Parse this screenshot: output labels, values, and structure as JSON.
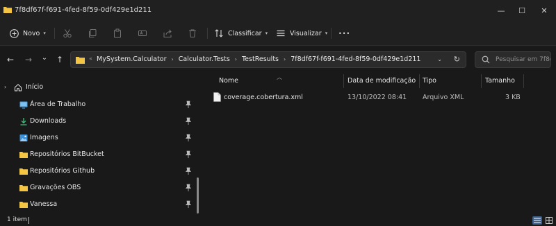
{
  "window": {
    "title": "7f8df67f-f691-4fed-8f59-0df429e1d211",
    "minimize_glyph": "—",
    "maximize_glyph": "☐",
    "close_glyph": "✕"
  },
  "toolbar": {
    "new_label": "Novo",
    "sort_label": "Classificar",
    "view_label": "Visualizar",
    "more_label": "•••",
    "icons": [
      "cut-icon",
      "copy-icon",
      "paste-icon",
      "rename-icon",
      "share-icon",
      "delete-icon"
    ]
  },
  "navigation": {
    "back_glyph": "←",
    "forward_glyph": "→",
    "recent_glyph": "⌄",
    "up_glyph": "↑"
  },
  "address": {
    "overflow": "«",
    "crumbs": [
      "MySystem.Calculator",
      "Calculator.Tests",
      "TestResults",
      "7f8df67f-f691-4fed-8f59-0df429e1d211"
    ],
    "separator": "›",
    "dropdown_glyph": "⌄",
    "refresh_glyph": "↻"
  },
  "search": {
    "placeholder": "Pesquisar em 7f8d..."
  },
  "sidebar": {
    "home_label": "Início",
    "items": [
      {
        "label": "Área de Trabalho",
        "icon": "desktop-icon"
      },
      {
        "label": "Downloads",
        "icon": "download-icon"
      },
      {
        "label": "Imagens",
        "icon": "pictures-icon"
      },
      {
        "label": "Repositórios BitBucket",
        "icon": "folder-icon"
      },
      {
        "label": "Repositórios Github",
        "icon": "folder-icon"
      },
      {
        "label": "Gravações OBS",
        "icon": "folder-icon"
      },
      {
        "label": "Vanessa",
        "icon": "folder-icon"
      }
    ]
  },
  "columns": {
    "name": "Nome",
    "modified": "Data de modificação",
    "type": "Tipo",
    "size": "Tamanho"
  },
  "files": [
    {
      "name": "coverage.cobertura.xml",
      "modified": "13/10/2022 08:41",
      "type": "Arquivo XML",
      "size": "3 KB"
    }
  ],
  "status": {
    "count_text": "1 item"
  },
  "colors": {
    "folder": "#f4c542",
    "accent": "#3d5f8a",
    "background": "#191919",
    "chrome": "#202020"
  }
}
